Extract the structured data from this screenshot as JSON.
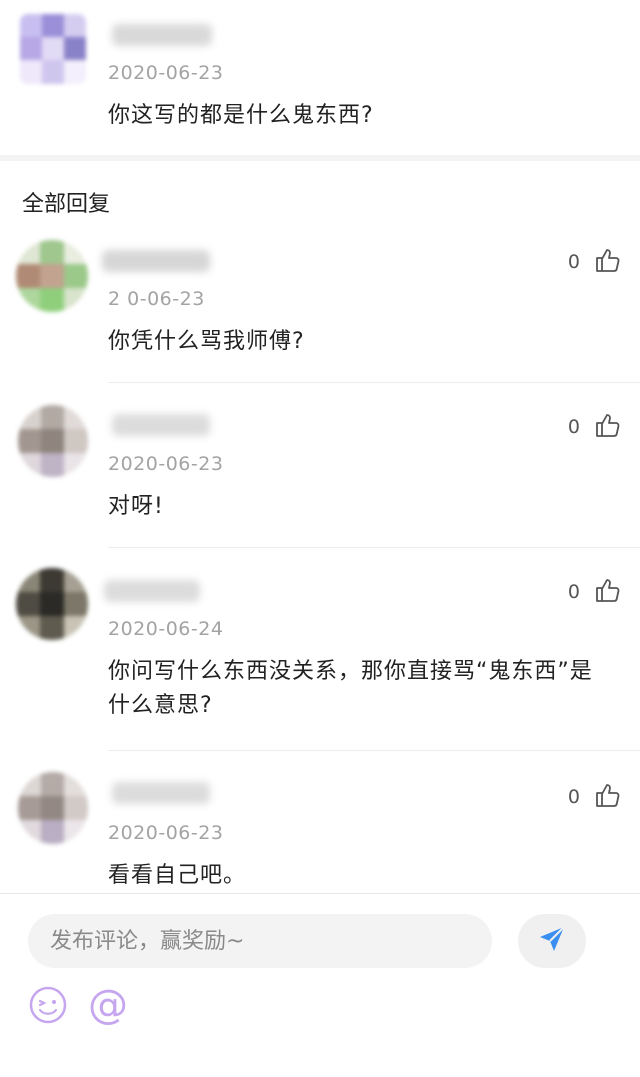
{
  "original_post": {
    "date": "2020-06-23",
    "text": "你这写的都是什么鬼东西?"
  },
  "section_title": "全部回复",
  "replies": [
    {
      "date": "2 0-06-23",
      "text": "你凭什么骂我师傅?",
      "likes": "0"
    },
    {
      "date": "2020-06-23",
      "text": "对呀!",
      "likes": "0"
    },
    {
      "date": "2020-06-24",
      "text": "你问写什么东西没关系，那你直接骂“鬼东西”是什么意思?",
      "likes": "0"
    },
    {
      "date": "2020-06-23",
      "text": "看看自己吧。",
      "likes": "0"
    }
  ],
  "composer": {
    "placeholder": "发布评论，赢奖励~",
    "send_icon": "send-icon",
    "emoji_icon": "emoji-icon",
    "mention_icon": "at-icon"
  },
  "colors": {
    "accent_send": "#3a8ef0",
    "icon_purple": "#c5a6ef",
    "date_gray": "#a3a3a3"
  }
}
